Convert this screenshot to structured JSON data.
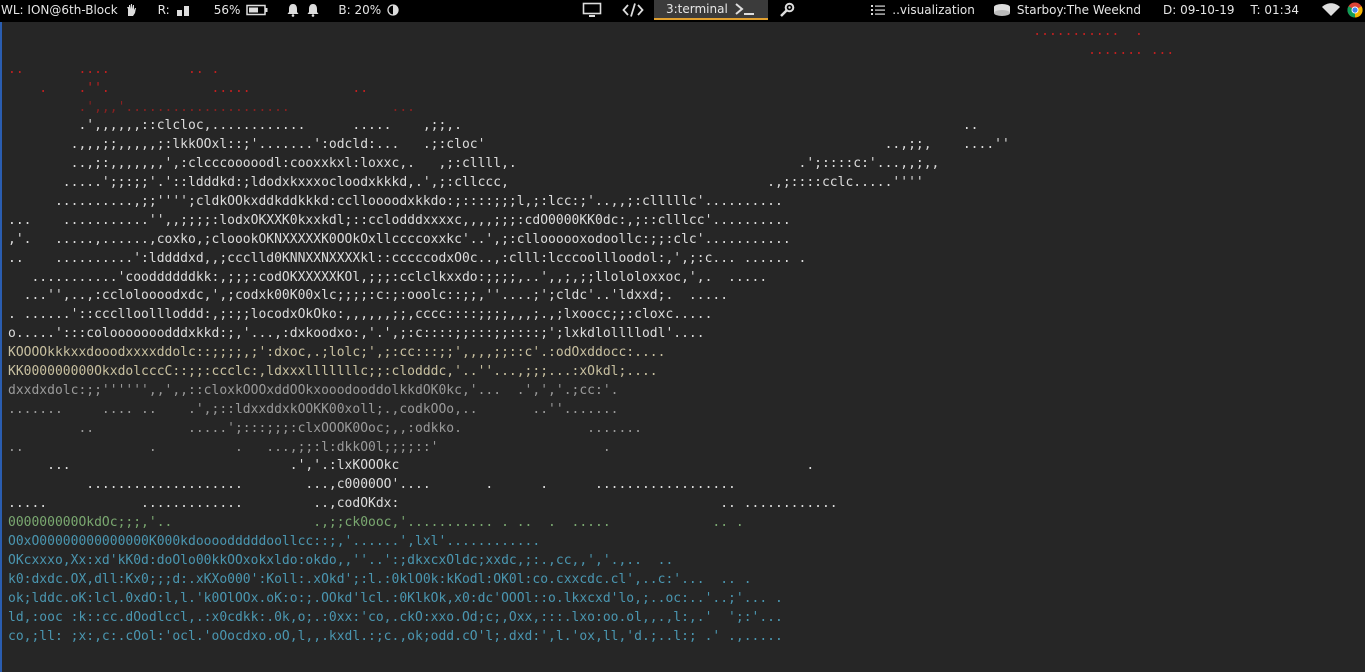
{
  "statusbar": {
    "wl_label": "WL: ION@6th-Block",
    "ram_label": "R:",
    "battery_percent": "56%",
    "brightness_label": "B: 20%",
    "workspaces": [
      {
        "label": "",
        "icon": "monitor-icon"
      },
      {
        "label": "",
        "icon": "code-icon"
      },
      {
        "label": "3:terminal",
        "icon": "terminal-icon"
      },
      {
        "label": "",
        "icon": "settings-icon"
      }
    ],
    "task_label": "..visualization",
    "music_label": "Starboy:The Weeknd",
    "date_label": "D: 09-10-19",
    "time_label": "T: 01:34",
    "accent_color": "#e0a030"
  },
  "terminal": {
    "lines": [
      {
        "text": "                                                                                                                                   ...........  .",
        "cls": "c-r"
      },
      {
        "text": "                                                                                                                                          ....... ...",
        "cls": "c-r"
      },
      {
        "text": "..       ....          .. .",
        "cls": "c-r"
      },
      {
        "text": "    .    .''.             .....             ..",
        "cls": "c-r"
      },
      {
        "text": "         .',,,'.....................             ...",
        "cls": "c-dr"
      },
      {
        "text": "         .',,,,,,::clcloc,............      .....    ,;;,.                                                                ..",
        "cls": "c-w"
      },
      {
        "text": "        .,,,;;,,,,,;:lkkOOxl::;'.......':odcld:...   .;:cloc'                                                   ..,;;,    ....''",
        "cls": "c-w"
      },
      {
        "text": "        ..,;:,,,,,,,',:clcccooooodl:cooxxkxl:loxxc,.   ,;:cllll,.                                    .';::::c:'...,,;,,",
        "cls": "c-w"
      },
      {
        "text": "       .....';;:;;'.'::ldddkd:;ldodxkxxxocloodxkkkd,.',;:cllccc,                                 .,;::::cclc.....''''",
        "cls": "c-w"
      },
      {
        "text": "      ..........,;;'''';cldkOOkxddkddkkkd:cclloooodxkkdo:;::::;;;l,;:lcc:;'..,,;:clllllc'..........",
        "cls": "c-w"
      },
      {
        "text": "...    ...........'',,;;;;:lodxOKXXK0kxxkdl;::cclodddxxxxc,,,,;;;:cdO0000KK0dc:,;::clllcc'..........",
        "cls": "c-w"
      },
      {
        "text": ",'.   .....,......,coxko,;cloookOKNXXXXXK0OOkOxllccccoxxkc'..',;:clloooooxodoollc:;;:clc'...........",
        "cls": "c-w"
      },
      {
        "text": "..    ..........':lddddxd,,;ccclld0KNNXXNXXXXkl::cccccodxO0c..,:clll:lcccoollloodol:,',;:c... ...... .",
        "cls": "c-w"
      },
      {
        "text": "   ...........'cooddddddkk:,;;;:codOKXXXXXKOl,;;;:cclclkxxdo:;;;;,..',,;,;;llololoxxoc,',.  .....",
        "cls": "c-w"
      },
      {
        "text": "  ...'',..,:ccloloooodxdc,',;codxk00K00xlc;;;;:c:;:ooolc::;;,''....;';cldc'..'ldxxd;.  .....",
        "cls": "c-w"
      },
      {
        "text": ". ......'::ccclloollloddd:,;:;;locodxOkOko:,,,,,,;;,cccc::::;;;;,,,;.,;lxoocc;;:cloxc.....",
        "cls": "c-w"
      },
      {
        "text": "o.....':::colooooooodddxkkd:;,'...,:dxkoodxo:,'.',;:c::::;;:::;;::::;';lxkdlollllodl'....",
        "cls": "c-w"
      },
      {
        "text": "KOOOOkkkxxdooodxxxxddolc::;;;;,;':dxoc,.;lolc;',;:cc:::;;',,,,;;::c'.:odOxddocc:....",
        "cls": "c-y"
      },
      {
        "text": "KK000000000OkxdolcccC::;;:ccclc:,ldxxxlllllllc;;:clodddc,'..''...,;;;...:xOkdl;....",
        "cls": "c-y"
      },
      {
        "text": "dxxdxdolc:;;'''''',,',,::cloxkOOOxddOOkxooodooddolkkdOK0kc,'...  .',','.;cc:'.",
        "cls": "c-g"
      },
      {
        "text": ".......     .... ..    .',;::ldxxddxkOOKK00xoll;.,codkOOo,..       ..''.......",
        "cls": "c-g"
      },
      {
        "text": "         ..            .....';:::;;;:clxOOOK0Ooc;,,:odkko.                .......",
        "cls": "c-g"
      },
      {
        "text": "..                .          .   ...,;;:l:dkkO0l;;;;::'                     .",
        "cls": "c-g"
      },
      {
        "text": "     ...                            .','.:lxKOOOkc                                                    .",
        "cls": "c-w"
      },
      {
        "text": "          ....................        ...,c0000OO'....       .      .      ..................",
        "cls": "c-w"
      },
      {
        "text": ".....            .............         ..,codOKdx:                                         .. ............",
        "cls": "c-w"
      },
      {
        "text": "000000000OkdOc;;;,'..                  .,;;ck0ooc,'........... . ..  .  .....             .. .",
        "cls": "c-gr"
      },
      {
        "text": "O0xO00000000000000K000kdoooodddddoollcc::;,'......',lxl'............",
        "cls": "c-t"
      },
      {
        "text": "OKcxxxo,Xx:xd'kK0d:doOlo00kkOOxokxldo:okdo,,''..':;dkxcxOldc;xxdc,;:.,cc,,','.,..  ..",
        "cls": "c-t"
      },
      {
        "text": "k0:dxdc.OX,dll:Kx0;;;d:.xKXo000':Koll:.xOkd';:l.:0klO0k:kKodl:OK0l:co.cxxcdc.cl',..c:'...  .. .",
        "cls": "c-t"
      },
      {
        "text": "ok;lddc.oK:lcl.0xdO:l,l.'k0OlOOx.oK:o:;.OOkd'lcl.:0KlkOk,x0:dc'OOOl::o.lkxcxd'lo,;..oc:..'..;'... .",
        "cls": "c-t"
      },
      {
        "text": "ld,:ooc :k::cc.dOodlccl,.:x0cdkk:.0k,o;.:0xx:'co,.ckO:xxo.Od;c;,Oxx,:::.lxo:oo.ol,,.,l:,.'  ';:'...",
        "cls": "c-t"
      },
      {
        "text": "co,;ll: ;x:,c:.cOol:'ocl.'oOocdxo.oO,l,,.kxdl.:;c.,ok;odd.cO'l;.dxd:',l.'ox,ll,'d.;..l:; .' .,.....",
        "cls": "c-t"
      }
    ]
  }
}
